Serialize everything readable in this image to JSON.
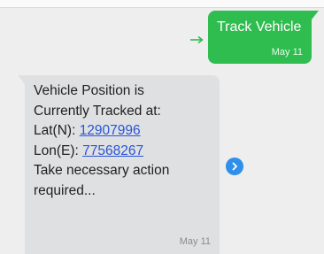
{
  "outgoing": {
    "text": "Track Vehicle",
    "time": "May 11",
    "status_icon": "arrow-right-icon",
    "bubble_color": "#2ebd4e"
  },
  "incoming": {
    "line1": "Vehicle Position is",
    "line2": "Currently Tracked at:",
    "lat_label": "Lat(N): ",
    "lat_value": "12907996",
    "lon_label": "Lon(E): ",
    "lon_value": "77568267",
    "line5": "Take necessary action",
    "line6": "required...",
    "time": "May 11",
    "bubble_color": "#dfe0e2",
    "link_color": "#2a55d6"
  },
  "share_button": {
    "icon": "chevron-right-icon",
    "color": "#2f8fea"
  }
}
